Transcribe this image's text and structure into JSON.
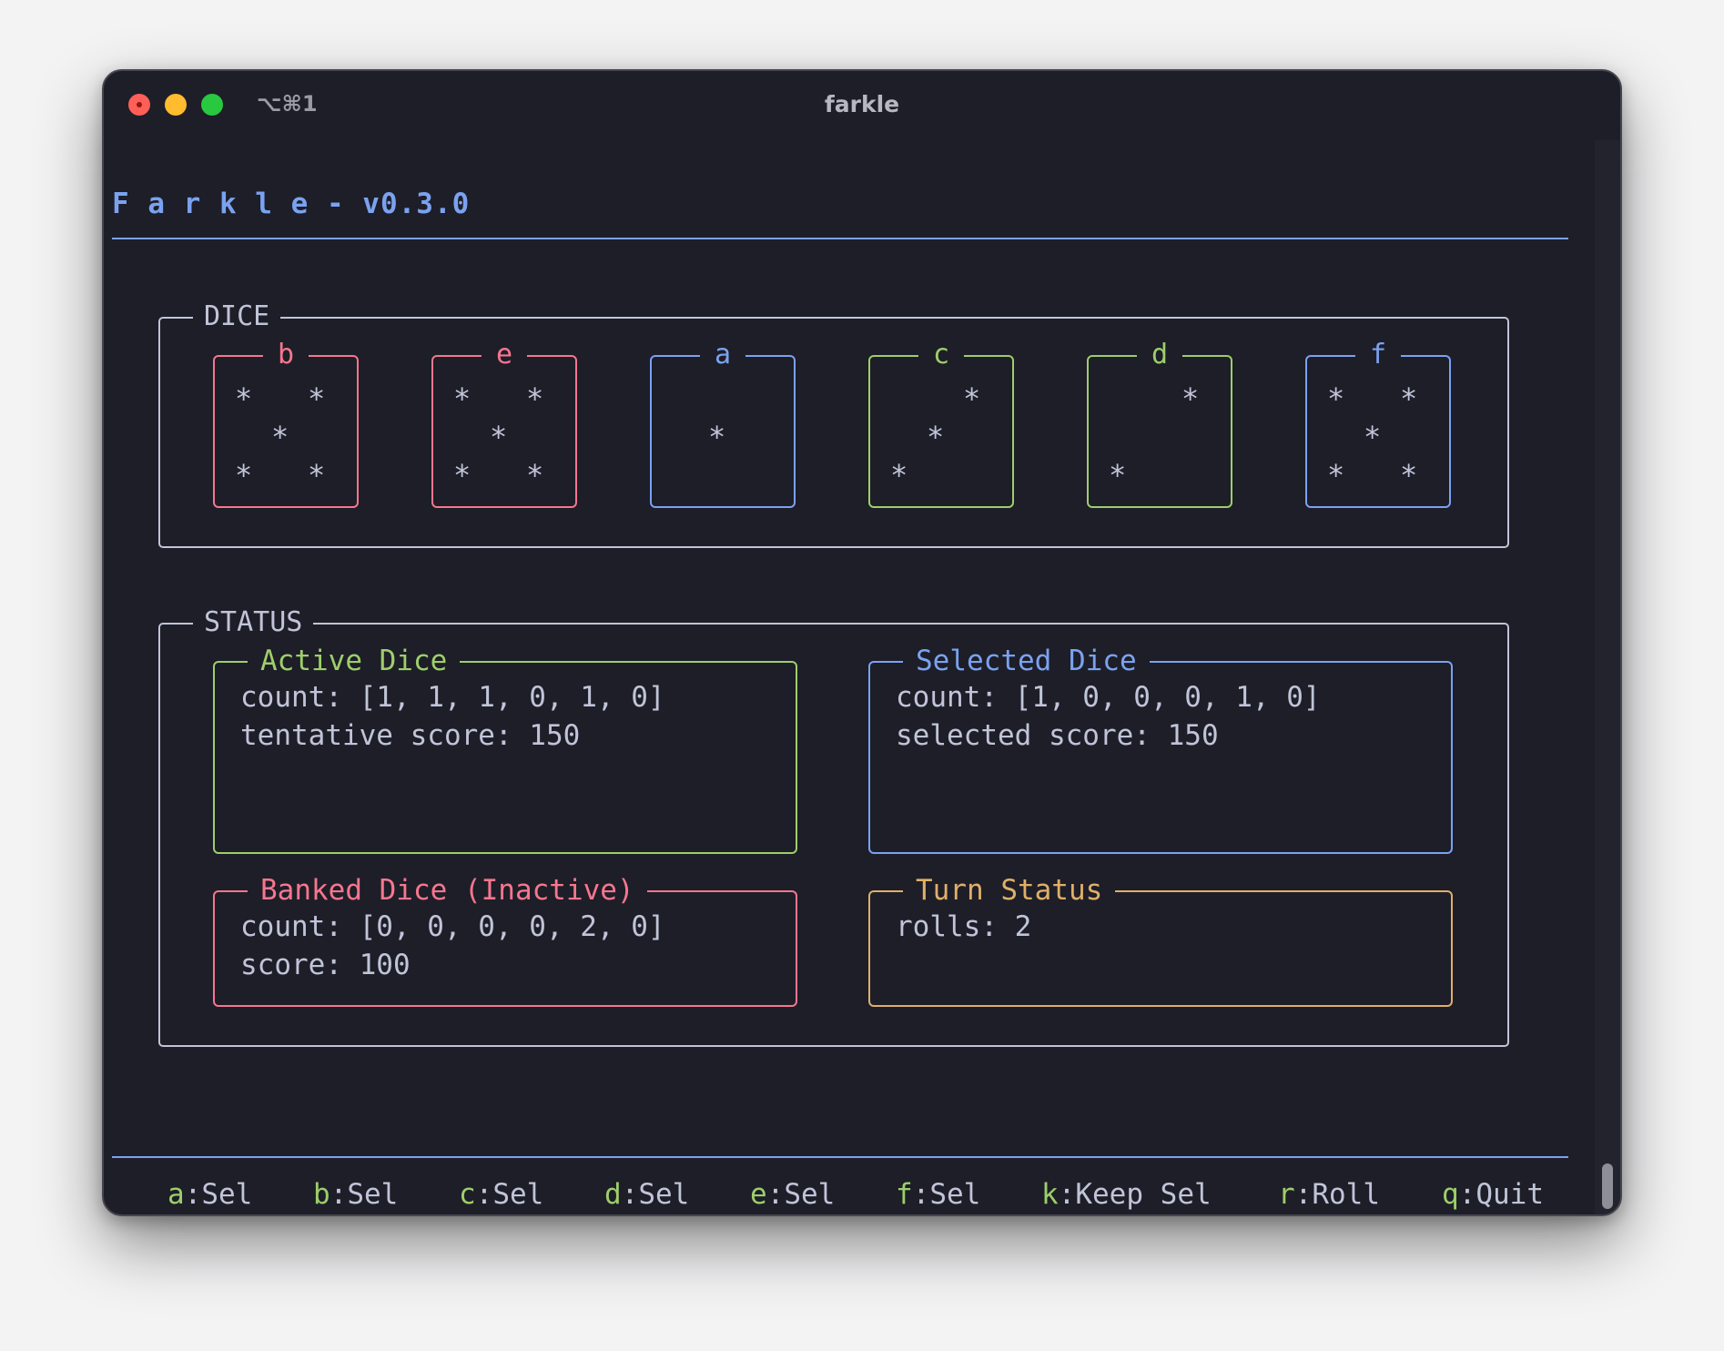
{
  "window": {
    "title": "farkle",
    "shortcut": "⌥⌘1"
  },
  "app": {
    "title": "F a r k l e - v0.3.0"
  },
  "dice_panel": {
    "title": "DICE",
    "dice": [
      {
        "label": "b",
        "value": 5,
        "color": "#f7768e"
      },
      {
        "label": "e",
        "value": 5,
        "color": "#f7768e"
      },
      {
        "label": "a",
        "value": 1,
        "color": "#7ba2f0"
      },
      {
        "label": "c",
        "value": 3,
        "color": "#9ece6a"
      },
      {
        "label": "d",
        "value": 2,
        "color": "#9ece6a"
      },
      {
        "label": "f",
        "value": 5,
        "color": "#7ba2f0"
      }
    ],
    "pip_glyph": "*"
  },
  "status_panel": {
    "title": "STATUS",
    "active": {
      "title": "Active Dice",
      "color": "#9ece6a",
      "count": "count: [1, 1, 1, 0, 1, 0]",
      "score": "tentative score: 150"
    },
    "selected": {
      "title": "Selected Dice",
      "color": "#7ba2f0",
      "count": "count: [1, 0, 0, 0, 1, 0]",
      "score": "selected score: 150"
    },
    "banked": {
      "title": "Banked Dice (Inactive)",
      "color": "#f7768e",
      "count": "count: [0, 0, 0, 0, 2, 0]",
      "score": "score: 100"
    },
    "turn": {
      "title": "Turn Status",
      "color": "#e0af68",
      "rolls": "rolls: 2"
    }
  },
  "keybindings": [
    {
      "key": "a",
      "action": ":Sel"
    },
    {
      "key": "b",
      "action": ":Sel"
    },
    {
      "key": "c",
      "action": ":Sel"
    },
    {
      "key": "d",
      "action": ":Sel"
    },
    {
      "key": "e",
      "action": ":Sel"
    },
    {
      "key": "f",
      "action": ":Sel"
    },
    {
      "key": "k",
      "action": ":Keep Sel"
    },
    {
      "key": "r",
      "action": ":Roll"
    },
    {
      "key": "q",
      "action": ":Quit"
    }
  ]
}
